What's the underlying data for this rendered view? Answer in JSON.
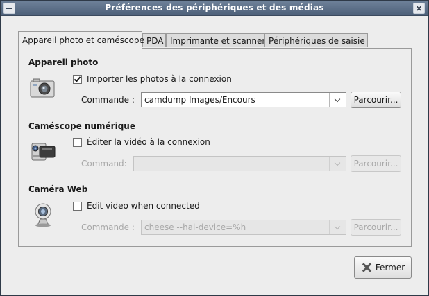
{
  "window": {
    "title": "Préférences des périphériques et des médias"
  },
  "tabs": [
    {
      "label": "Appareil photo et caméscope",
      "active": true
    },
    {
      "label": "PDA",
      "active": false
    },
    {
      "label": "Imprimante et scanner",
      "active": false
    },
    {
      "label": "Périphériques de saisie",
      "active": false
    }
  ],
  "camera": {
    "title": "Appareil photo",
    "checkbox_label": "Importer les photos à la connexion",
    "checked": true,
    "command_label": "Commande :",
    "command_value": "camdump Images/Encours",
    "browse_label": "Parcourir..."
  },
  "camcorder": {
    "title": "Caméscope numérique",
    "checkbox_label": "Éditer la vidéo à la connexion",
    "checked": false,
    "command_label": "Command:",
    "command_value": "",
    "browse_label": "Parcourir..."
  },
  "webcam": {
    "title": "Caméra Web",
    "checkbox_label": "Edit video when connected",
    "checked": false,
    "command_label": "Commande :",
    "command_value": "cheese --hal-device=%h",
    "browse_label": "Parcourir..."
  },
  "footer": {
    "close_label": "Fermer"
  }
}
